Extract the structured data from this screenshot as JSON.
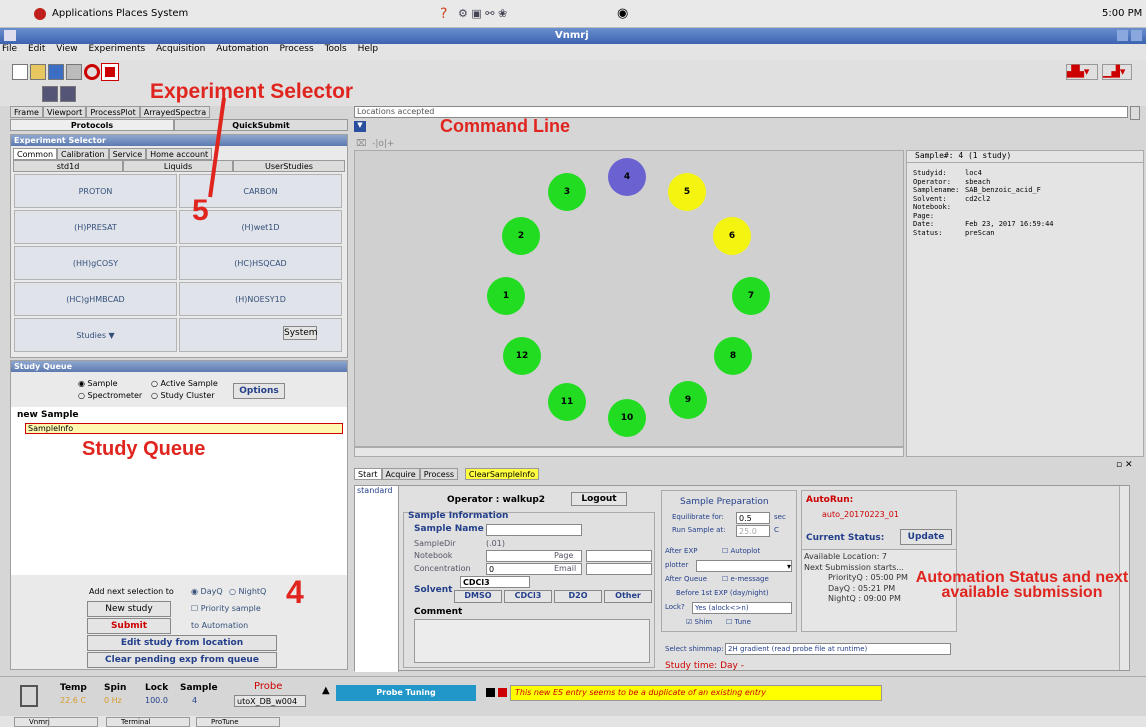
{
  "topbar": {
    "menus": [
      "Applications",
      "Places",
      "System"
    ],
    "clock": "5:00 PM"
  },
  "window": {
    "title": "Vnmrj"
  },
  "menubar": [
    "File",
    "Edit",
    "View",
    "Experiments",
    "Acquisition",
    "Automation",
    "Process",
    "Tools",
    "Help"
  ],
  "annotations": {
    "experiment_selector": "Experiment Selector",
    "command_line": "Command Line",
    "study_queue": "Study Queue",
    "automation": "Automation Status and next available submission",
    "num5": "5",
    "num4": "4"
  },
  "left_tabs": [
    "Frame",
    "Viewport",
    "ProcessPlot",
    "ArrayedSpectra"
  ],
  "left_subtabs": [
    "Protocols",
    "QuickSubmit"
  ],
  "exp_selector": {
    "title": "Experiment Selector",
    "tabs": [
      "Common",
      "Calibration",
      "Service",
      "Home account"
    ],
    "subtabs": [
      "std1d",
      "Liquids",
      "UserStudies"
    ],
    "cells": [
      "PROTON",
      "CARBON",
      "(H)PRESAT",
      "(H)wet1D",
      "(HH)gCOSY",
      "(HC)HSQCAD",
      "(HC)gHMBCAD",
      "(H)NOESY1D",
      "Studies ▼",
      "System"
    ]
  },
  "study_queue": {
    "title": "Study Queue",
    "radio": [
      "Sample",
      "Active Sample",
      "Spectrometer",
      "Study Cluster"
    ],
    "options": "Options",
    "tree_root": "new Sample",
    "tree_child": "SampleInfo",
    "add_next": "Add next selection to",
    "dayq": "DayQ",
    "nightq": "NightQ",
    "new_study": "New study",
    "priority": "Priority sample",
    "submit": "Submit",
    "to_auto": "to Automation",
    "edit_study": "Edit study from location",
    "clear_pending": "Clear pending exp from queue"
  },
  "command_line": {
    "text": "Locations accepted"
  },
  "sample_numbers": [
    "1",
    "2",
    "3",
    "4",
    "5",
    "6",
    "7",
    "8",
    "9",
    "10",
    "11",
    "12"
  ],
  "sample_info": {
    "header": "Sample#: 4  (1 study)",
    "rows": [
      [
        "Studyid:",
        "loc4"
      ],
      [
        "Operator:",
        "sbeach"
      ],
      [
        "Samplename:",
        "SAB_benzoic_acid_F"
      ],
      [
        "Solvent:",
        "cd2cl2"
      ],
      [
        "Notebook:",
        ""
      ],
      [
        "Page:",
        ""
      ],
      [
        "Date:",
        "Feb 23, 2017 16:59:44"
      ],
      [
        "Status:",
        "preScan"
      ]
    ]
  },
  "bottom_tabs": [
    "Start",
    "Acquire",
    "Process",
    "ClearSampleInfo"
  ],
  "form": {
    "side": "standard",
    "operator": "Operator : walkup2",
    "logout": "Logout",
    "sample_information": "Sample Information",
    "sample_name": "Sample Name",
    "sampledir": "SampleDir",
    "sampledir_val": "(.01)",
    "notebook": "Notebook",
    "page": "Page",
    "concentration": "Concentration",
    "conc_val": "0",
    "email": "Email",
    "solvent": "Solvent",
    "solvent_sel": "CDCl3",
    "solvents": [
      "DMSO",
      "CDCl3",
      "D2O",
      "Other"
    ],
    "comment": "Comment"
  },
  "prep": {
    "title": "Sample Preparation",
    "equil": "Equilibrate for:",
    "equil_val": "0.5",
    "sec": "sec",
    "runat": "Run Sample at:",
    "runat_val": "25.0",
    "c": "C",
    "after_exp": "After EXP",
    "autoplot": "Autoplot",
    "plotter": "plotter",
    "after_queue": "After Queue",
    "emessage": "e-message",
    "before": "Before 1st EXP (day/night)",
    "lock": "Lock?",
    "lock_val": "Yes (alock<>n)",
    "shim": "Shim",
    "tune": "Tune",
    "shimmap_lbl": "Select shimmap:",
    "shimmap_val": "2H gradient (read probe file at runtime)",
    "studytime": "Study time: Day -"
  },
  "autorun": {
    "title": "AutoRun:",
    "name": "auto_20170223_01",
    "status_lbl": "Current Status:",
    "update": "Update",
    "lines": [
      "Available Location: 7",
      "Next Submission starts...",
      "PriorityQ : 05:00 PM",
      "DayQ : 05:21 PM",
      "NightQ : 09:00 PM"
    ]
  },
  "statusbar": {
    "temp": "Temp",
    "temp_val": "22.6 C",
    "spin": "Spin",
    "spin_val": "0 Hz",
    "lock": "Lock",
    "lock_val": "100.0",
    "sample": "Sample",
    "sample_val": "4",
    "probe": "Probe",
    "probe_val": "utoX_DB_w004",
    "tuning": "Probe Tuning",
    "message": "This new ES entry seems to be a duplicate of an existing entry"
  },
  "taskbar": [
    "Vnmrj",
    "Terminal",
    "ProTune"
  ]
}
